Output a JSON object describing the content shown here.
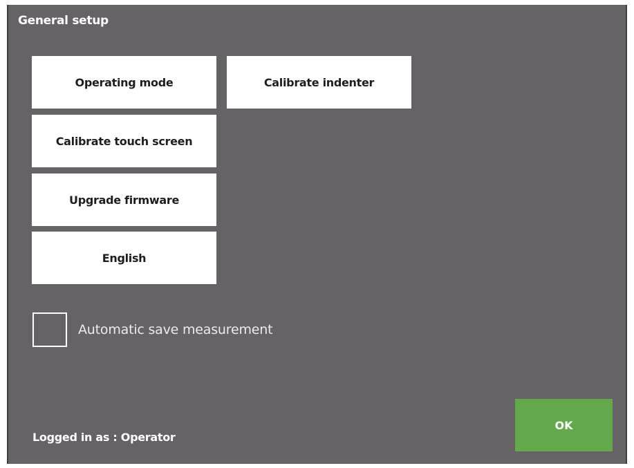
{
  "window": {
    "title": "General setup"
  },
  "buttons": {
    "operating_mode": "Operating mode",
    "calibrate_indenter": "Calibrate indenter",
    "calibrate_touch_screen": "Calibrate touch screen",
    "upgrade_firmware": "Upgrade firmware",
    "language": "English"
  },
  "options": {
    "auto_save_label": "Automatic save measurement",
    "auto_save_checked": false
  },
  "footer": {
    "login_status": "Logged in as : Operator",
    "ok_label": "OK"
  },
  "colors": {
    "background": "#656365",
    "button": "#ffffff",
    "ok_button": "#64a84c"
  }
}
